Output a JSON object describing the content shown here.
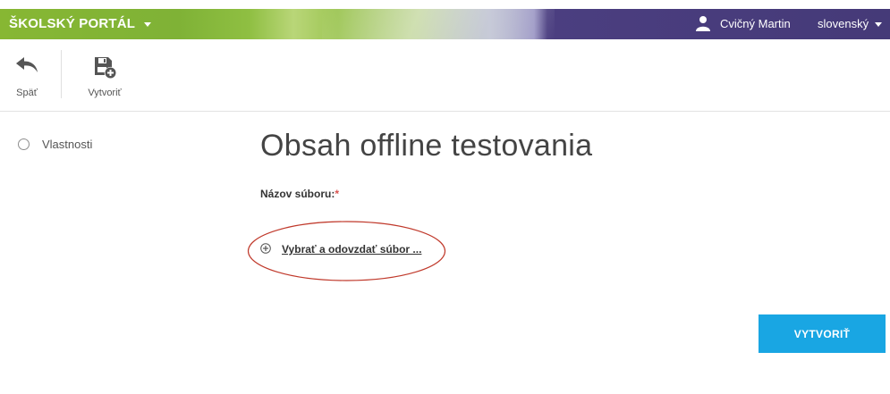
{
  "header": {
    "brand": "ŠKOLSKÝ PORTÁL",
    "user_name": "Cvičný Martin",
    "language": "slovenský"
  },
  "toolbar": {
    "back_label": "Späť",
    "create_label": "Vytvoriť"
  },
  "sidebar": {
    "items": [
      {
        "label": "Vlastnosti"
      }
    ]
  },
  "main": {
    "title": "Obsah offline testovania",
    "file_label": "Názov súboru:",
    "required_marker": "*",
    "file_link": "Vybrať a odovzdať súbor ...",
    "create_button": "VYTVORIŤ"
  },
  "colors": {
    "primary_button": "#19a6e3",
    "header_green": "#87b733",
    "header_purple": "#453a78",
    "annotation_ellipse": "#c0392b"
  }
}
